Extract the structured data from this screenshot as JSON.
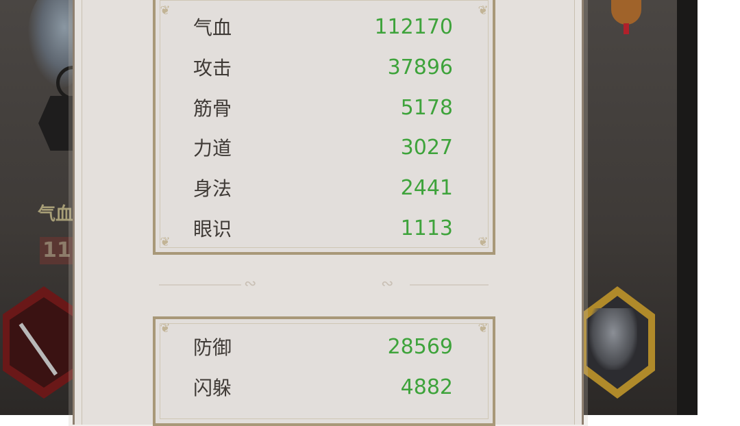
{
  "panel": {
    "group1": [
      {
        "name": "气血",
        "value": "112170"
      },
      {
        "name": "攻击",
        "value": "37896"
      },
      {
        "name": "筋骨",
        "value": "5178"
      },
      {
        "name": "力道",
        "value": "3027"
      },
      {
        "name": "身法",
        "value": "2441"
      },
      {
        "name": "眼识",
        "value": "1113"
      }
    ],
    "group2": [
      {
        "name": "防御",
        "value": "28569"
      },
      {
        "name": "闪躲",
        "value": "4882"
      }
    ]
  },
  "background": {
    "hp_label": "气血",
    "hp_value": "11"
  },
  "colors": {
    "value_green": "#3ea33b",
    "label_dark": "#3f3a36",
    "panel_bg": "#e6e2de",
    "box_border": "#a89878"
  },
  "icons": [
    "spear-icon",
    "elephant-mount-icon",
    "tassel-ornament-icon",
    "flourish-ornament-icon"
  ]
}
